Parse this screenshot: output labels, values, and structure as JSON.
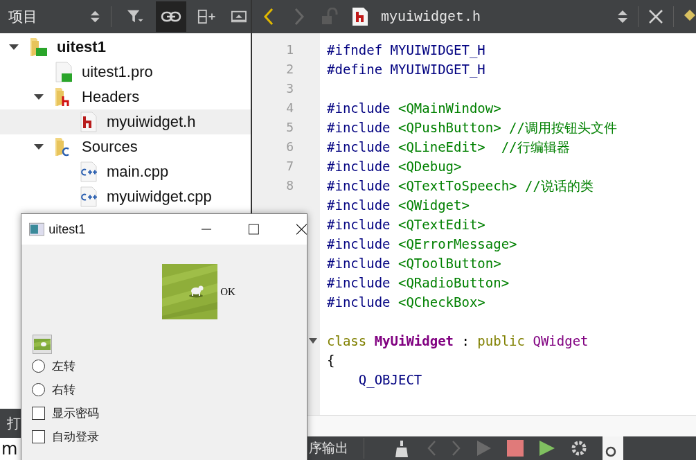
{
  "sidebar": {
    "title": "项目",
    "tree": [
      {
        "label": "uitest1",
        "kind": "project",
        "expanded": true,
        "selected": false,
        "children": [
          {
            "label": "uitest1.pro",
            "kind": "pro-file",
            "selected": false
          },
          {
            "label": "Headers",
            "kind": "header-folder",
            "expanded": true,
            "selected": false,
            "children": [
              {
                "label": "myuiwidget.h",
                "kind": "header-file",
                "selected": true
              }
            ]
          },
          {
            "label": "Sources",
            "kind": "source-folder",
            "expanded": true,
            "selected": false,
            "children": [
              {
                "label": "main.cpp",
                "kind": "source-file",
                "selected": false
              },
              {
                "label": "myuiwidget.cpp",
                "kind": "source-file",
                "selected": false
              }
            ]
          }
        ]
      }
    ]
  },
  "bottom_left": {
    "tab_label": "打",
    "field_value": "m"
  },
  "editor": {
    "file_name": "myuiwidget.h",
    "line_numbers": [
      "1",
      "2",
      "3",
      "4",
      "5",
      "6",
      "7",
      "8"
    ],
    "lines": [
      {
        "tokens": [
          {
            "kind": "directive",
            "text": "#ifndef "
          },
          {
            "kind": "macro",
            "text": "MYUIWIDGET_H"
          }
        ]
      },
      {
        "tokens": [
          {
            "kind": "directive",
            "text": "#define "
          },
          {
            "kind": "macro",
            "text": "MYUIWIDGET_H"
          }
        ]
      },
      {
        "gap_before": true,
        "tokens": [
          {
            "kind": "directive",
            "text": "#include "
          },
          {
            "kind": "string",
            "text": "<QMainWindow>"
          }
        ]
      },
      {
        "tokens": [
          {
            "kind": "directive",
            "text": "#include "
          },
          {
            "kind": "string",
            "text": "<QPushButton>"
          },
          {
            "kind": "comment",
            "text": " //调用按钮头文件"
          }
        ]
      },
      {
        "tokens": [
          {
            "kind": "directive",
            "text": "#include "
          },
          {
            "kind": "string",
            "text": "<QLineEdit>"
          },
          {
            "kind": "comment",
            "text": "  //行编辑器"
          }
        ]
      },
      {
        "tokens": [
          {
            "kind": "directive",
            "text": "#include "
          },
          {
            "kind": "string",
            "text": "<QDebug>"
          }
        ]
      },
      {
        "tokens": [
          {
            "kind": "directive",
            "text": "#include "
          },
          {
            "kind": "string",
            "text": "<QTextToSpeech>"
          },
          {
            "kind": "comment",
            "text": " //说话的类"
          }
        ]
      },
      {
        "tokens": [
          {
            "kind": "directive",
            "text": "#include "
          },
          {
            "kind": "string",
            "text": "<QWidget>"
          }
        ]
      },
      {
        "tokens": [
          {
            "kind": "directive",
            "text": "#include "
          },
          {
            "kind": "string",
            "text": "<QTextEdit>"
          }
        ]
      },
      {
        "tokens": [
          {
            "kind": "directive",
            "text": "#include "
          },
          {
            "kind": "string",
            "text": "<QErrorMessage>"
          }
        ]
      },
      {
        "tokens": [
          {
            "kind": "directive",
            "text": "#include "
          },
          {
            "kind": "string",
            "text": "<QToolButton>"
          }
        ]
      },
      {
        "tokens": [
          {
            "kind": "directive",
            "text": "#include "
          },
          {
            "kind": "string",
            "text": "<QRadioButton>"
          }
        ]
      },
      {
        "tokens": [
          {
            "kind": "directive",
            "text": "#include "
          },
          {
            "kind": "string",
            "text": "<QCheckBox>"
          }
        ]
      },
      {
        "gap_before": true,
        "foldable": true,
        "tokens": [
          {
            "kind": "keyword",
            "text": "class "
          },
          {
            "kind": "class-name",
            "text": "MyUiWidget"
          },
          {
            "kind": "plain",
            "text": " : "
          },
          {
            "kind": "keyword",
            "text": "public "
          },
          {
            "kind": "type",
            "text": "QWidget"
          }
        ]
      },
      {
        "tokens": [
          {
            "kind": "plain",
            "text": "{"
          }
        ]
      },
      {
        "tokens": [
          {
            "kind": "macro",
            "text": "    Q_OBJECT"
          }
        ]
      }
    ]
  },
  "output_bar": {
    "label": "序输出"
  },
  "dialog": {
    "title": "uitest1",
    "image_button_label": "OK",
    "options": [
      {
        "kind": "radio",
        "label": "左转",
        "selected": false
      },
      {
        "kind": "radio",
        "label": "右转",
        "selected": false
      },
      {
        "kind": "checkbox",
        "label": "显示密码",
        "checked": false
      },
      {
        "kind": "checkbox",
        "label": "自动登录",
        "checked": false
      }
    ]
  }
}
